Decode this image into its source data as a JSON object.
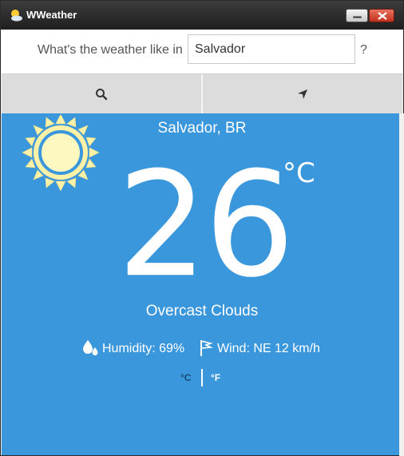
{
  "window": {
    "title": "WWeather",
    "app_icon": "sun-cloud-icon"
  },
  "search": {
    "question": "What's the weather like in",
    "city_value": "Salvador",
    "question_mark": "?"
  },
  "toolbar": {
    "search_icon": "search-icon",
    "locate_icon": "location-arrow-icon"
  },
  "weather": {
    "location": "Salvador, BR",
    "temperature": "26",
    "temperature_unit": "°C",
    "condition": "Overcast Clouds",
    "condition_icon": "sun-icon",
    "humidity": "Humidity: 69%",
    "wind": "Wind: NE 12 km/h"
  },
  "units": {
    "celsius": "°C",
    "fahrenheit": "°F",
    "selected": "°C"
  },
  "colors": {
    "panel": "#3a97dc",
    "sun_fill": "#fdf8c0",
    "sun_rays": "#fcf1a7",
    "sun_ring": "#3a97dc"
  }
}
